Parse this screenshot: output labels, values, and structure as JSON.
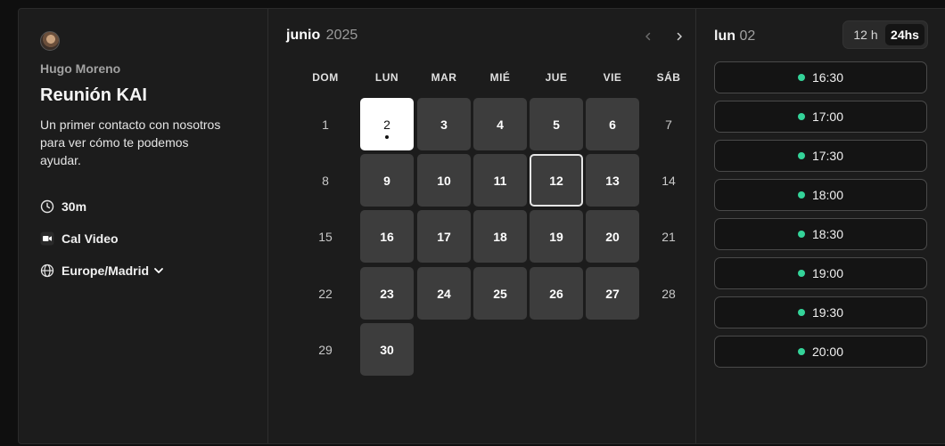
{
  "event": {
    "host": "Hugo Moreno",
    "title": "Reunión KAI",
    "description": "Un primer contacto con nosotros para ver cómo te podemos ayudar.",
    "duration": "30m",
    "location": "Cal Video",
    "timezone": "Europe/Madrid"
  },
  "calendar": {
    "month": "junio",
    "year": "2025",
    "weekdays": [
      "DOM",
      "LUN",
      "MAR",
      "MIÉ",
      "JUE",
      "VIE",
      "SÁB"
    ],
    "weeks": [
      [
        null,
        "2",
        "3",
        "4",
        "5",
        "6",
        "7"
      ],
      [
        "8",
        "9",
        "10",
        "11",
        "12",
        "13",
        "14"
      ],
      [
        "15",
        "16",
        "17",
        "18",
        "19",
        "20",
        "21"
      ],
      [
        "22",
        "23",
        "24",
        "25",
        "26",
        "27",
        "28"
      ],
      [
        "29",
        "30",
        null,
        null,
        null,
        null,
        null
      ]
    ],
    "first_day": "1",
    "selected_day": "2",
    "today": "12"
  },
  "slots": {
    "day_name": "lun",
    "day_number": "02",
    "format_12": "12 h",
    "format_24": "24hs",
    "active_format": "24hs",
    "times": [
      "16:30",
      "17:00",
      "17:30",
      "18:00",
      "18:30",
      "19:00",
      "19:30",
      "20:00"
    ],
    "available_color": "#34d399"
  }
}
